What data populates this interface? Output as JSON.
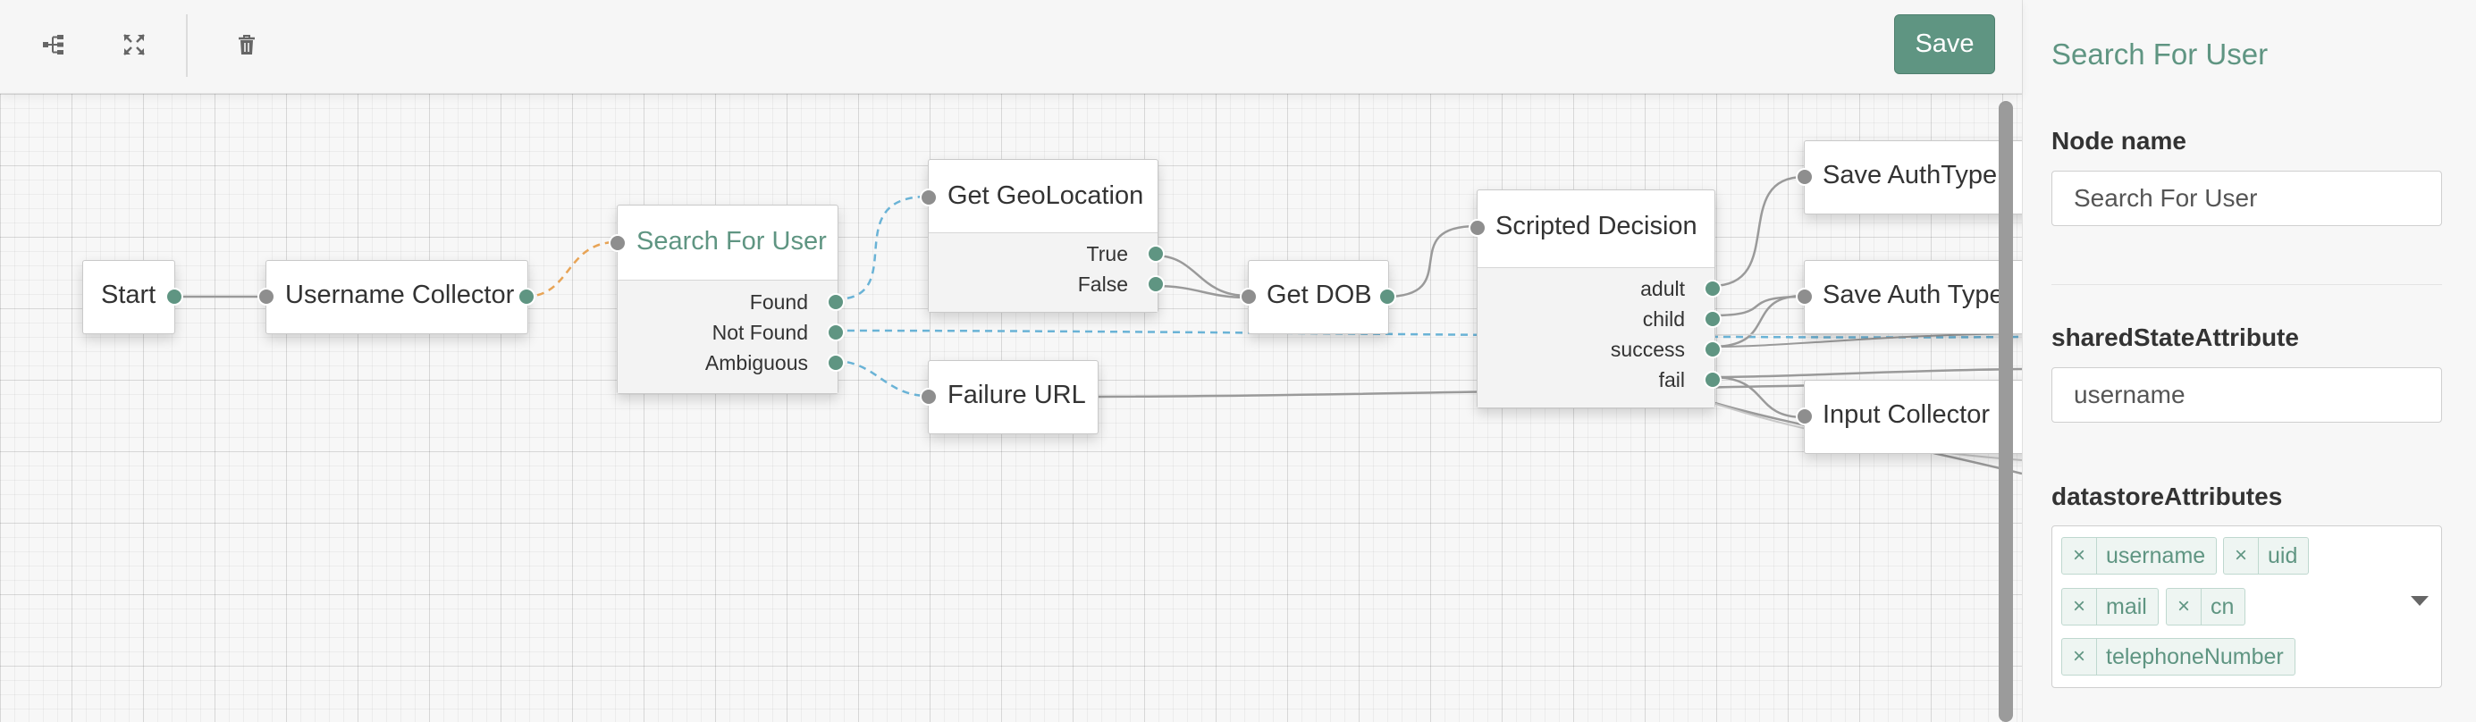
{
  "toolbar": {
    "icons": [
      "tree-layout-icon",
      "expand-icon",
      "trash-icon"
    ],
    "save_label": "Save"
  },
  "nodes": {
    "start": {
      "title": "Start"
    },
    "username_collector": {
      "title": "Username Collector"
    },
    "search_for_user": {
      "title": "Search For User",
      "outcomes": [
        "Found",
        "Not Found",
        "Ambiguous"
      ]
    },
    "get_geolocation": {
      "title": "Get GeoLocation",
      "outcomes": [
        "True",
        "False"
      ]
    },
    "failure_url": {
      "title": "Failure URL"
    },
    "get_dob": {
      "title": "Get DOB"
    },
    "scripted_decision": {
      "title": "Scripted Decision",
      "outcomes": [
        "adult",
        "child",
        "success",
        "fail"
      ]
    },
    "save_authtype": {
      "title": "Save AuthType"
    },
    "save_auth_type": {
      "title": "Save Auth Type"
    },
    "input_collector": {
      "title": "Input Collector"
    }
  },
  "panel": {
    "title": "Search For User",
    "node_name": {
      "label": "Node name",
      "value": "Search For User"
    },
    "shared_state": {
      "label": "sharedStateAttribute",
      "value": "username"
    },
    "datastore": {
      "label": "datastoreAttributes",
      "tags": [
        "username",
        "uid",
        "mail",
        "cn",
        "telephoneNumber"
      ]
    }
  },
  "colors": {
    "accent": "#5f9582",
    "selected_link": "#e8a456",
    "dashed_link": "#6ab3d6"
  }
}
